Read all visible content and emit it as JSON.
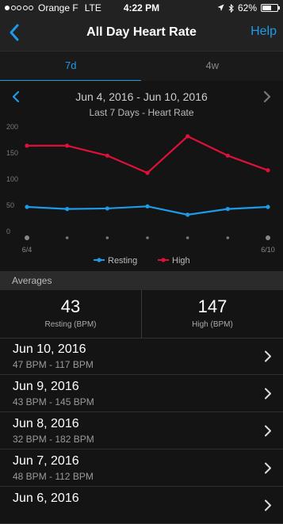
{
  "status_bar": {
    "carrier": "Orange F",
    "network": "LTE",
    "time": "4:22 PM",
    "battery": "62%",
    "battery_level": 0.62,
    "signal_bars": 1
  },
  "nav": {
    "title": "All Day Heart Rate",
    "help": "Help"
  },
  "tabs": [
    {
      "label": "7d",
      "active": true
    },
    {
      "label": "4w",
      "active": false
    }
  ],
  "chart": {
    "date_range": "Jun 4, 2016 - Jun 10, 2016",
    "subtitle": "Last 7 Days - Heart Rate"
  },
  "chart_data": {
    "type": "line",
    "title": "Last 7 Days - Heart Rate",
    "x": [
      "6/4",
      "6/5",
      "6/6",
      "6/7",
      "6/8",
      "6/9",
      "6/10"
    ],
    "x_labels_shown": [
      "6/4",
      "6/10"
    ],
    "series": [
      {
        "name": "Resting",
        "color": "#1e9be8",
        "values": [
          47,
          43,
          44,
          48,
          32,
          43,
          47
        ]
      },
      {
        "name": "High",
        "color": "#e0103a",
        "values": [
          164,
          164,
          145,
          112,
          182,
          145,
          117
        ]
      }
    ],
    "y_ticks": [
      "200",
      "150",
      "100",
      "50",
      "0"
    ],
    "ylim": [
      0,
      200
    ],
    "grid": false,
    "legend_position": "bottom"
  },
  "averages": {
    "title": "Averages",
    "resting_value": "43",
    "resting_label": "Resting (BPM)",
    "high_value": "147",
    "high_label": "High (BPM)"
  },
  "days": [
    {
      "date": "Jun 10, 2016",
      "range": "47 BPM - 117 BPM"
    },
    {
      "date": "Jun 9, 2016",
      "range": "43 BPM - 145 BPM"
    },
    {
      "date": "Jun 8, 2016",
      "range": "32 BPM - 182 BPM"
    },
    {
      "date": "Jun 7, 2016",
      "range": "48 BPM - 112 BPM"
    },
    {
      "date": "Jun 6, 2016",
      "range": ""
    }
  ],
  "colors": {
    "accent": "#1e9be8",
    "high": "#e0103a"
  }
}
